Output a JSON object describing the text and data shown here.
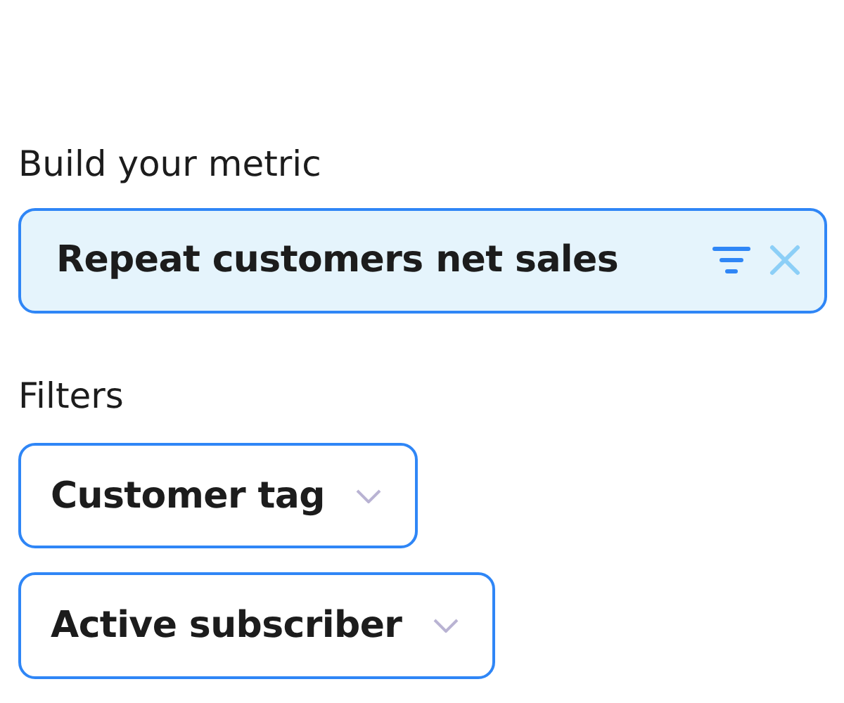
{
  "metric_section": {
    "label": "Build your metric",
    "metric": {
      "name": "Repeat customers net sales"
    }
  },
  "filters_section": {
    "label": "Filters",
    "filters": [
      {
        "label": "Customer tag"
      },
      {
        "label": "Active subscriber"
      }
    ]
  }
}
